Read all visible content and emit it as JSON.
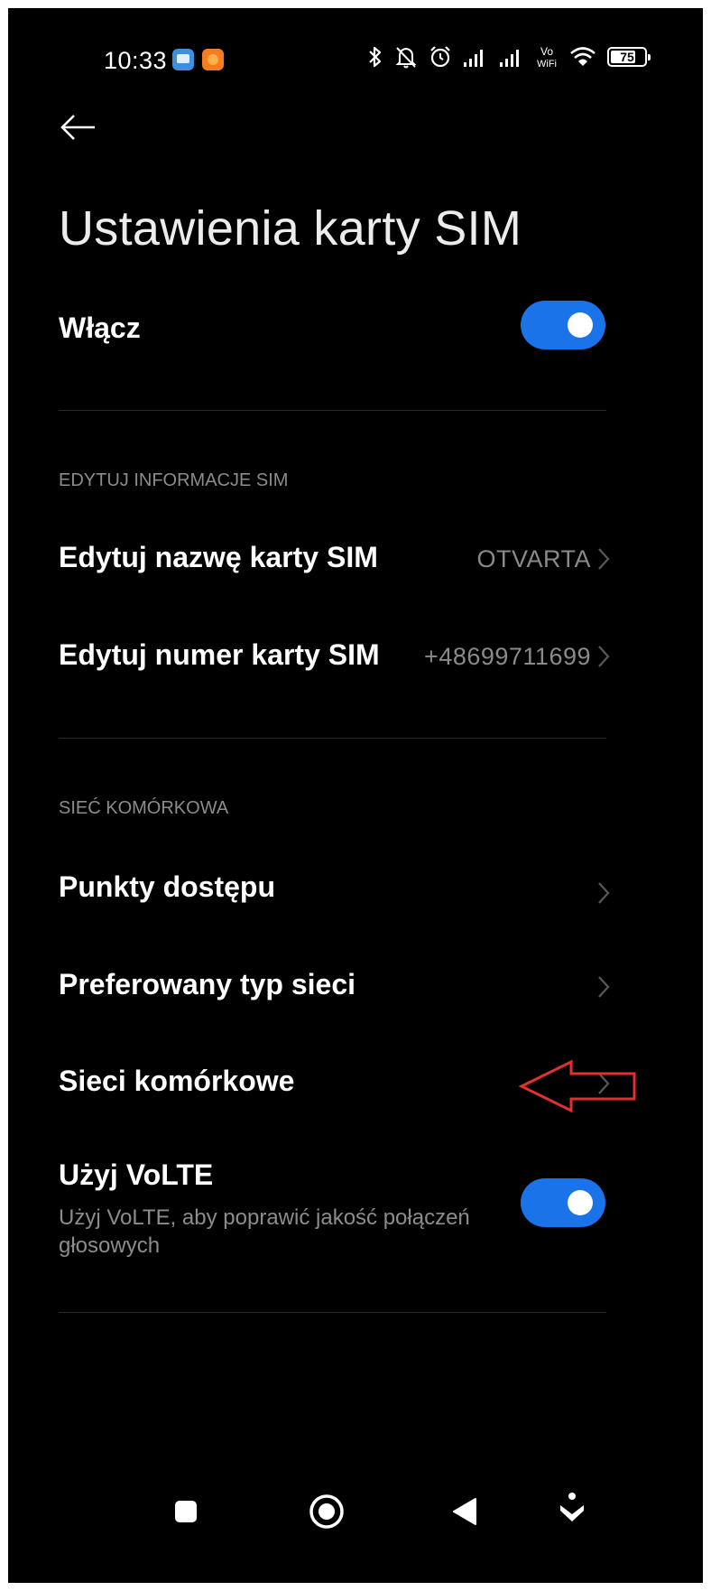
{
  "status_bar": {
    "time": "10:33",
    "notification_icons": [
      "app-notification-icon-blue",
      "app-notification-icon-orange"
    ],
    "icons": [
      "bluetooth-icon",
      "muted-bell-icon",
      "alarm-icon",
      "signal-icon",
      "signal-icon",
      "vowifi-icon",
      "wifi-icon",
      "battery-icon"
    ],
    "vowifi_top": "Vo",
    "vowifi_bottom": "WiFi",
    "battery_level": "75"
  },
  "header": {
    "back_icon": "arrow-left-icon",
    "title": "Ustawienia karty SIM"
  },
  "main_toggle": {
    "label": "Włącz",
    "enabled": true
  },
  "section_edit": {
    "header": "EDYTUJ INFORMACJE SIM",
    "items": [
      {
        "label": "Edytuj nazwę karty SIM",
        "value": "OTVARTA"
      },
      {
        "label": "Edytuj numer karty SIM",
        "value": "+48699711699"
      }
    ]
  },
  "section_network": {
    "header": "SIEĆ KOMÓRKOWA",
    "items": [
      {
        "label": "Punkty dostępu"
      },
      {
        "label": "Preferowany typ sieci"
      },
      {
        "label": "Sieci komórkowe"
      }
    ],
    "volte": {
      "label": "Użyj VoLTE",
      "subtitle": "Użyj VoLTE, aby poprawić jakość połączeń głosowych",
      "enabled": true
    }
  },
  "annotation": {
    "type": "red-arrow-pointing-left",
    "color": "#e03030"
  },
  "nav_bar": {
    "buttons": [
      "recents-square-icon",
      "home-circle-icon",
      "back-triangle-icon",
      "hide-nav-arrow-icon"
    ]
  },
  "colors": {
    "background": "#000000",
    "accent": "#1a73e8",
    "secondary_text": "#8c8c8c"
  }
}
